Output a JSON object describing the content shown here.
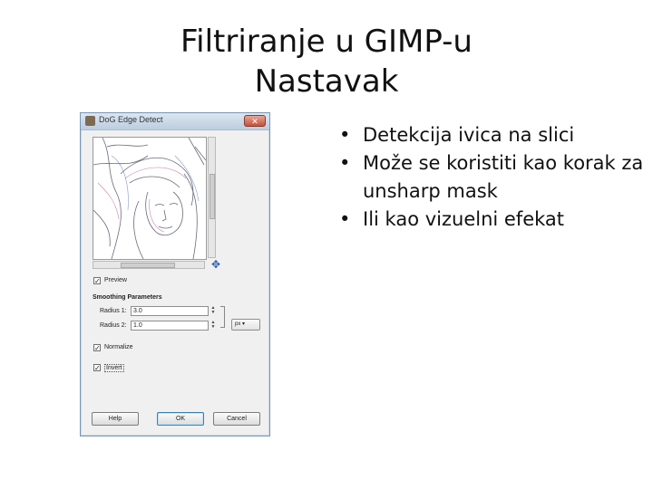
{
  "slide": {
    "title_line1": "Filtriranje u GIMP-u",
    "title_line2": "Nastavak",
    "bullets": [
      "Detekcija ivica na slici",
      "Može se koristiti kao korak za unsharp mask",
      "Ili kao vizuelni efekat"
    ]
  },
  "dialog": {
    "title": "DoG Edge Detect",
    "close_glyph": "✕",
    "preview_label": "Preview",
    "preview_checked": true,
    "section_title": "Smoothing Parameters",
    "radius1_label": "Radius 1:",
    "radius1_value": "3.0",
    "radius2_label": "Radius 2:",
    "radius2_value": "1.0",
    "unit_value": "px",
    "normalize_label": "Normalize",
    "normalize_checked": true,
    "invert_label": "Invert",
    "invert_checked": true,
    "buttons": {
      "help": "Help",
      "ok": "OK",
      "cancel": "Cancel"
    },
    "icons": {
      "nav": "move-icon",
      "preview_image": "edge-detected-portrait-image"
    }
  }
}
